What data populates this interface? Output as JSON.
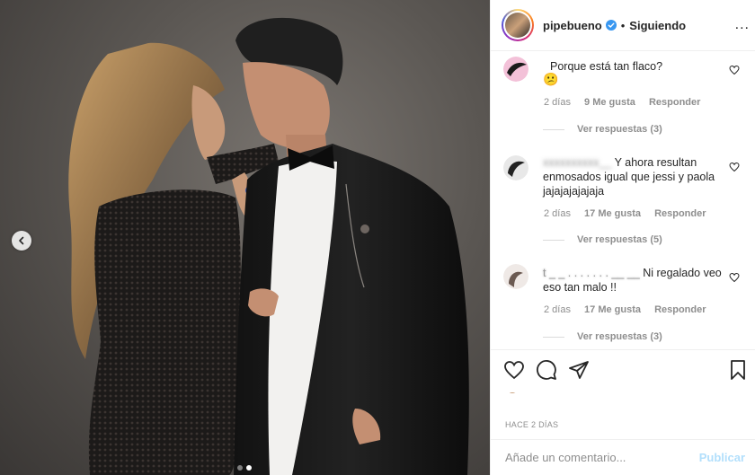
{
  "post": {
    "carousel": {
      "total_slides": 2,
      "current_slide": 2
    }
  },
  "header": {
    "username": "pipebueno",
    "separator": "•",
    "follow_status": "Siguiendo",
    "more_label": "..."
  },
  "comments": [
    {
      "text": "Porque está tan flaco?",
      "emoji": "😕",
      "age": "2 días",
      "likes": "9 Me gusta",
      "reply_label": "Responder",
      "view_replies": "Ver respuestas (3)"
    },
    {
      "text": "Y ahora resultan enmosados igual que jessi y paola jajajajajajaja",
      "age": "2 días",
      "likes": "17 Me gusta",
      "reply_label": "Responder",
      "view_replies": "Ver respuestas (5)"
    },
    {
      "name_fragment": "t _ _ . . . . . . . __ __",
      "text": "Ni regalado veo eso tan malo !!",
      "age": "2 días",
      "likes": "17 Me gusta",
      "reply_label": "Responder",
      "view_replies": "Ver respuestas (3)"
    }
  ],
  "footer": {
    "timestamp": "HACE 2 DÍAS",
    "comment_placeholder": "Añade un comentario...",
    "publish_label": "Publicar"
  }
}
